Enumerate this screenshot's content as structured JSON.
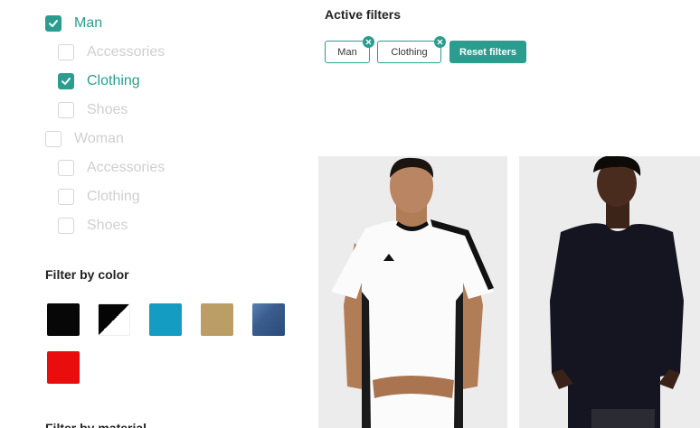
{
  "filters": {
    "categories": [
      {
        "label": "Man",
        "checked": true,
        "level": 0
      },
      {
        "label": "Accessories",
        "checked": false,
        "level": 1
      },
      {
        "label": "Clothing",
        "checked": true,
        "level": 1
      },
      {
        "label": "Shoes",
        "checked": false,
        "level": 1
      },
      {
        "label": "Woman",
        "checked": false,
        "level": 0
      },
      {
        "label": "Accessories",
        "checked": false,
        "level": 1
      },
      {
        "label": "Clothing",
        "checked": false,
        "level": 1
      },
      {
        "label": "Shoes",
        "checked": false,
        "level": 1
      }
    ],
    "color_title": "Filter by color",
    "colors": [
      {
        "name": "black",
        "hex": "#070707"
      },
      {
        "name": "black-white",
        "hex": "#050505/#ffffff"
      },
      {
        "name": "blue",
        "hex": "#149cc3"
      },
      {
        "name": "gold",
        "hex": "#bb9e66"
      },
      {
        "name": "denim",
        "hex": "#3a5d8e"
      },
      {
        "name": "red",
        "hex": "#ea0d0d"
      }
    ],
    "material_title_partial": "Filter by material"
  },
  "active_filters": {
    "title": "Active filters",
    "chips": [
      "Man",
      "Clothing"
    ],
    "reset_label": "Reset filters"
  },
  "products": [
    {
      "alt": "white sport t-shirt"
    },
    {
      "alt": "black knit sweater"
    }
  ],
  "theme": {
    "accent": "#2a9d8f"
  }
}
